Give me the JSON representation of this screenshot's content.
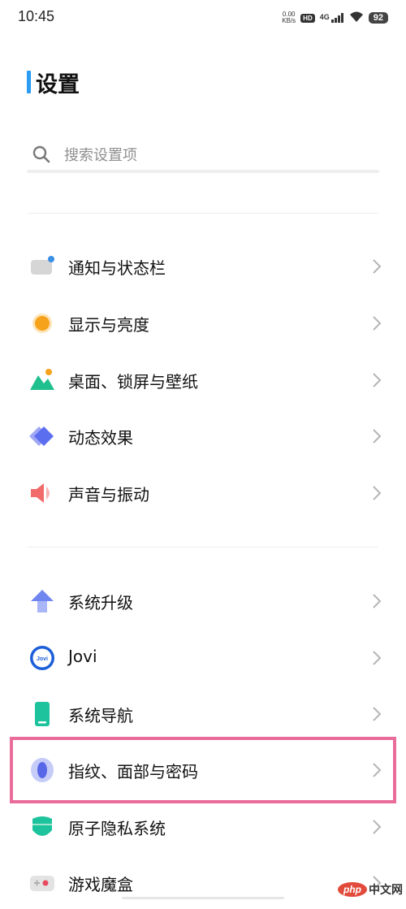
{
  "status_bar": {
    "time": "10:45",
    "net_speed_value": "0.00",
    "net_speed_unit": "KB/s",
    "hd": "HD",
    "network": "4G",
    "battery": "92"
  },
  "header": {
    "title": "设置"
  },
  "search": {
    "placeholder": "搜索设置项"
  },
  "groups": [
    {
      "items": [
        {
          "label": "通知与状态栏",
          "icon": "notification-icon"
        },
        {
          "label": "显示与亮度",
          "icon": "brightness-icon"
        },
        {
          "label": "桌面、锁屏与壁纸",
          "icon": "wallpaper-icon"
        },
        {
          "label": "动态效果",
          "icon": "animation-icon"
        },
        {
          "label": "声音与振动",
          "icon": "sound-icon"
        }
      ]
    },
    {
      "items": [
        {
          "label": "系统升级",
          "icon": "upgrade-icon"
        },
        {
          "label": "Jovi",
          "icon": "jovi-icon"
        },
        {
          "label": "系统导航",
          "icon": "navigation-icon"
        },
        {
          "label": "指纹、面部与密码",
          "icon": "fingerprint-icon",
          "highlighted": true
        },
        {
          "label": "原子隐私系统",
          "icon": "privacy-icon"
        },
        {
          "label": "游戏魔盒",
          "icon": "game-box-icon"
        }
      ]
    }
  ],
  "jovi_icon_text": "Jovi",
  "watermark": {
    "logo": "php",
    "text": "中文网"
  },
  "colors": {
    "accent": "#2b9cf2",
    "highlight_border": "#e96c9a"
  }
}
